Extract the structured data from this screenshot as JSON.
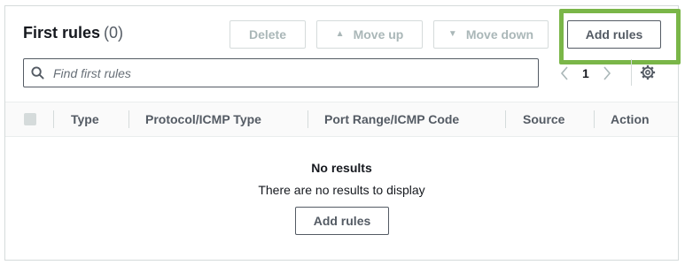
{
  "header": {
    "title": "First rules",
    "count": "(0)",
    "delete_label": "Delete",
    "move_up_label": "Move up",
    "move_down_label": "Move down",
    "add_rules_label": "Add rules"
  },
  "search": {
    "placeholder": "Find first rules"
  },
  "pagination": {
    "current_page": "1",
    "prev_icon": "chevron-left-icon",
    "next_icon": "chevron-right-icon",
    "settings_icon": "gear-icon"
  },
  "table": {
    "columns": [
      "Type",
      "Protocol/ICMP Type",
      "Port Range/ICMP Code",
      "Source",
      "Action"
    ]
  },
  "empty_state": {
    "title": "No results",
    "description": "There are no results to display",
    "button_label": "Add rules"
  },
  "colors": {
    "highlight": "#7ab648",
    "border": "#d5dbdb",
    "text_primary": "#16191f",
    "text_secondary": "#545b64",
    "disabled": "#aab7b8"
  }
}
